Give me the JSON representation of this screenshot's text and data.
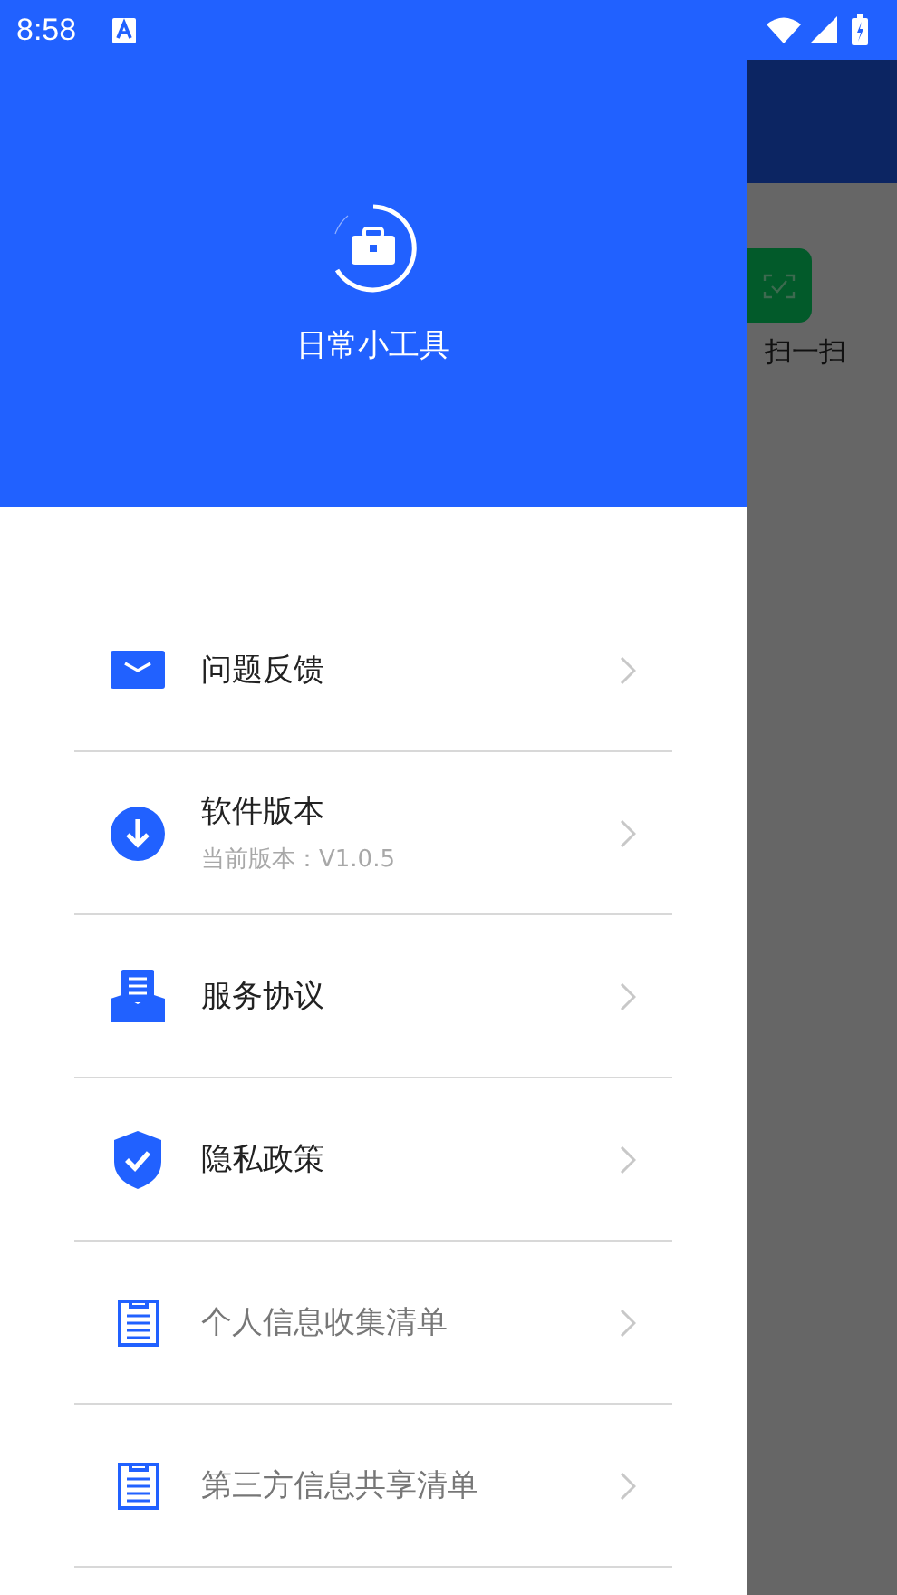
{
  "status_bar": {
    "time": "8:58"
  },
  "drawer": {
    "app_name": "日常小工具",
    "items": [
      {
        "kind": "mail",
        "label": "问题反馈",
        "muted": false
      },
      {
        "kind": "download",
        "label": "软件版本",
        "subtitle": "当前版本：V1.0.5",
        "muted": false
      },
      {
        "kind": "agreement",
        "label": "服务协议",
        "muted": false
      },
      {
        "kind": "shield",
        "label": "隐私政策",
        "muted": false
      },
      {
        "kind": "clipboard",
        "label": "个人信息收集清单",
        "muted": true
      },
      {
        "kind": "clipboard",
        "label": "第三方信息共享清单",
        "muted": true
      }
    ]
  },
  "background": {
    "tile_label": "扫一扫"
  }
}
